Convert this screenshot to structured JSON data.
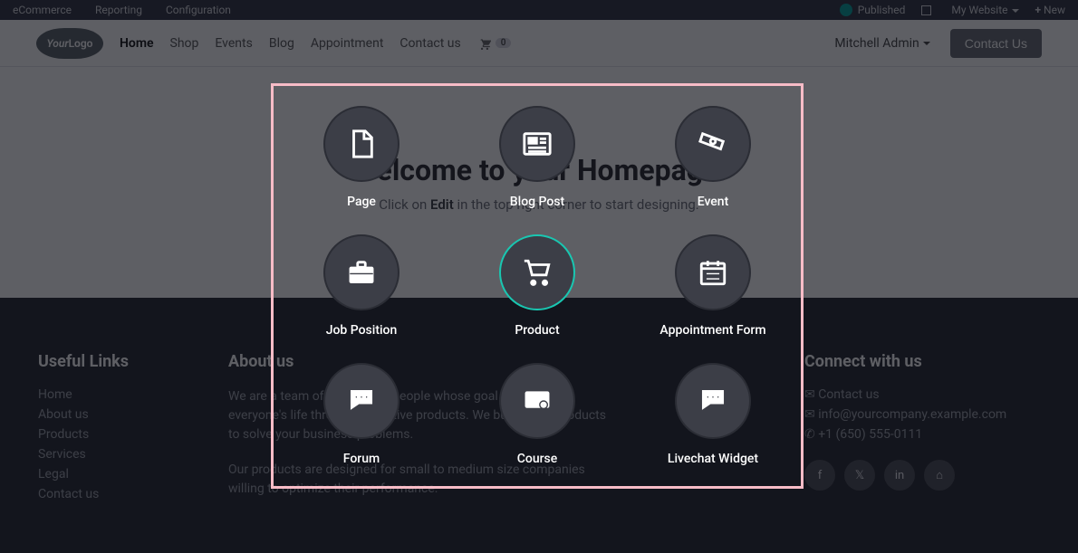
{
  "admin_bar": {
    "left": [
      "eCommerce",
      "Reporting",
      "Configuration"
    ],
    "published": "Published",
    "my_website": "My Website",
    "new": "New"
  },
  "nav": {
    "items": [
      "Home",
      "Shop",
      "Events",
      "Blog",
      "Appointment",
      "Contact us"
    ],
    "active_index": 0,
    "cart_count": "0",
    "user": "Mitchell Admin",
    "contact_btn": "Contact Us"
  },
  "hero": {
    "title": "Welcome to your Homepage!",
    "subtitle_pre": "Click on ",
    "subtitle_bold": "Edit",
    "subtitle_post": " in the top right corner to start designing."
  },
  "footer": {
    "useful_links_title": "Useful Links",
    "useful_links": [
      "Home",
      "About us",
      "Products",
      "Services",
      "Legal",
      "Contact us"
    ],
    "about_title": "About us",
    "about_p1": "We are a team of passionate people whose goal is to improve everyone's life through disruptive products. We build great products to solve your business problems.",
    "about_p2": "Our products are designed for small to medium size companies willing to optimize their performance.",
    "connect_title": "Connect with us",
    "contact_label": "Contact us",
    "email": "info@yourcompany.example.com",
    "phone": "+1 (650) 555-0111"
  },
  "modal": {
    "options": [
      {
        "label": "Page",
        "icon": "file"
      },
      {
        "label": "Blog Post",
        "icon": "news"
      },
      {
        "label": "Event",
        "icon": "ticket"
      },
      {
        "label": "Job Position",
        "icon": "briefcase"
      },
      {
        "label": "Product",
        "icon": "cart",
        "hover": true
      },
      {
        "label": "Appointment Form",
        "icon": "calendar"
      },
      {
        "label": "Forum",
        "icon": "chat"
      },
      {
        "label": "Course",
        "icon": "course"
      },
      {
        "label": "Livechat Widget",
        "icon": "chat"
      }
    ]
  }
}
